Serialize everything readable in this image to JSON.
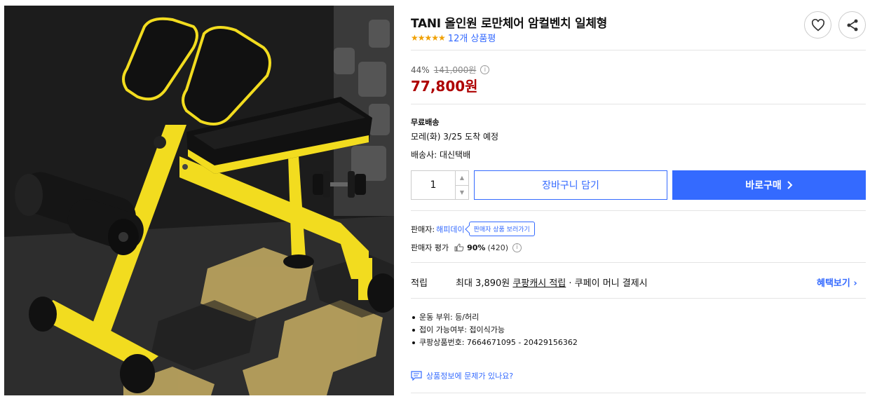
{
  "product": {
    "title": "TANI 올인원 로만체어 암컬벤치 일체형",
    "stars": "★★★★★",
    "review_count": "12개 상품평"
  },
  "price": {
    "discount": "44%",
    "original": "141,000원",
    "sale": "77,800원"
  },
  "shipping": {
    "label": "무료배송",
    "arrival": "모레(화) 3/25 도착 예정",
    "carrier": "배송사: 대신택배"
  },
  "purchase": {
    "quantity": "1",
    "up_arrow": "▲",
    "down_arrow": "▼",
    "cart_label": "장바구니 담기",
    "buy_label": "바로구매"
  },
  "seller": {
    "label": "판매자:",
    "name": "해피데이",
    "tooltip": "판매자 상품 보러가기",
    "rating_label": "판매자 평가",
    "rating_pct": "90%",
    "rating_count": "(420)"
  },
  "points": {
    "label": "적립",
    "prefix": "최대 3,890원 ",
    "link": "쿠팡캐시 적립",
    "suffix": " · 쿠페이 머니 결제시",
    "benefit_label": "혜택보기 ›"
  },
  "attributes": [
    "운동 부위: 등/허리",
    "접이 가능여부: 접이식가능",
    "쿠팡상품번호: 7664671095 - 20429156362"
  ],
  "report": {
    "label": "상품정보에 문제가 있나요?"
  },
  "colors": {
    "accent": "#346aff",
    "sale_price": "#ae0000",
    "star": "#f0a000",
    "bench_yellow": "#f2dc1f"
  }
}
